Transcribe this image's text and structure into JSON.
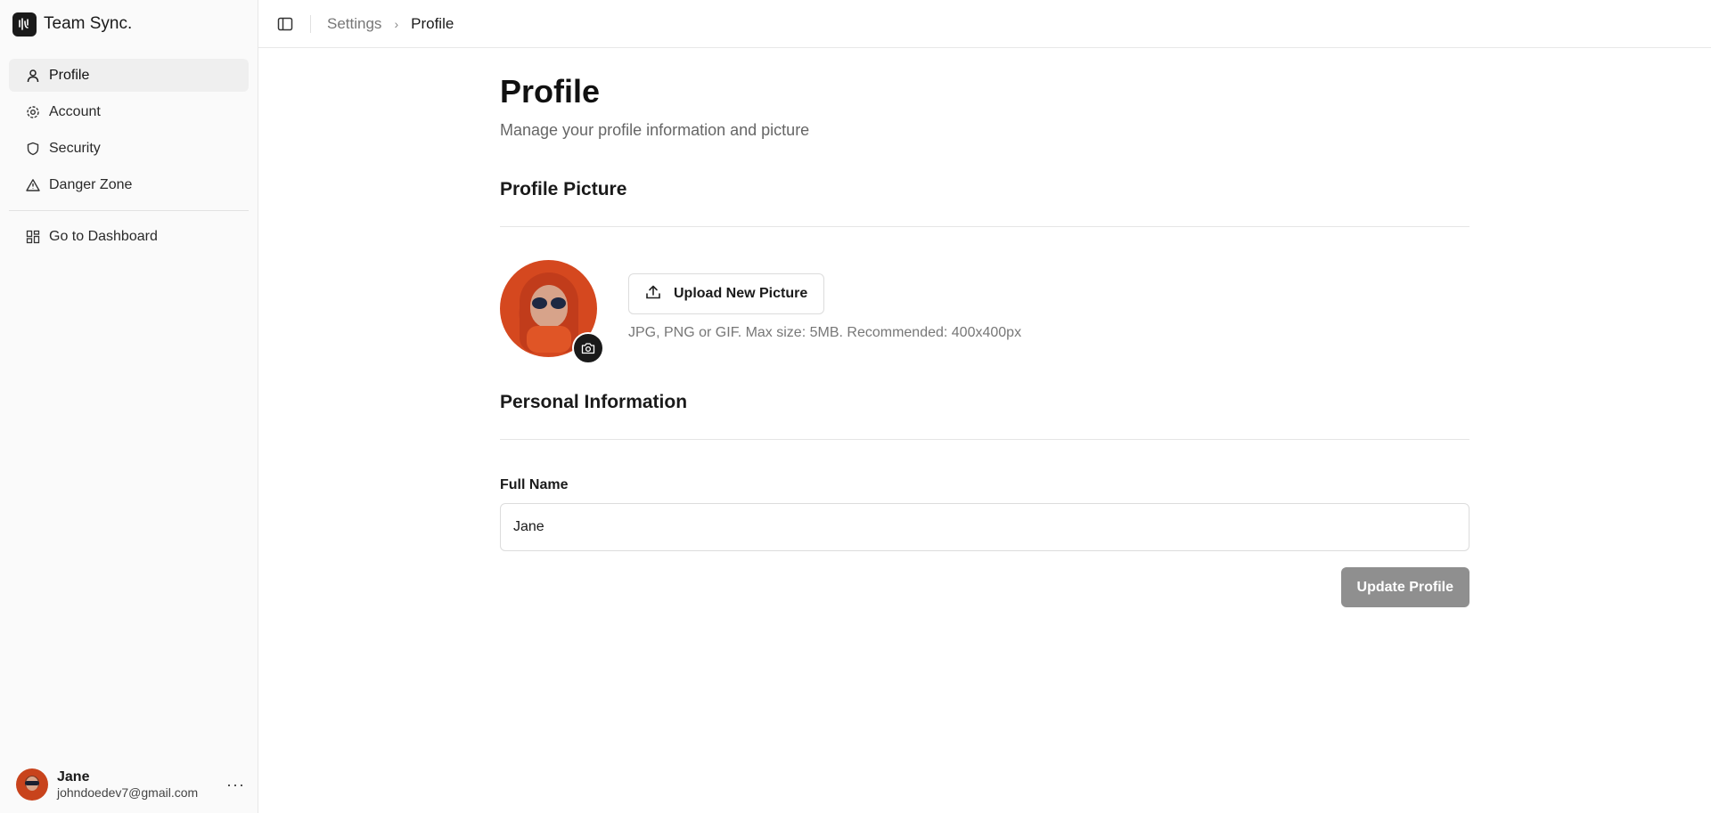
{
  "app": {
    "name": "Team Sync."
  },
  "sidebar": {
    "items": [
      {
        "label": "Profile",
        "icon": "user-icon",
        "active": true
      },
      {
        "label": "Account",
        "icon": "gear-icon"
      },
      {
        "label": "Security",
        "icon": "shield-icon"
      },
      {
        "label": "Danger Zone",
        "icon": "warning-triangle-icon"
      }
    ],
    "dashboard_link": {
      "label": "Go to Dashboard",
      "icon": "dashboard-grid-icon"
    },
    "user": {
      "name": "Jane",
      "email": "johndoedev7@gmail.com",
      "more": "···"
    }
  },
  "breadcrumb": {
    "items": [
      "Settings",
      "Profile"
    ],
    "separator": "›"
  },
  "page": {
    "title": "Profile",
    "subtitle": "Manage your profile information and picture"
  },
  "profile_picture": {
    "section_title": "Profile Picture",
    "upload_label": "Upload New Picture",
    "hint": "JPG, PNG or GIF. Max size: 5MB. Recommended: 400x400px"
  },
  "personal_info": {
    "section_title": "Personal Information",
    "full_name_label": "Full Name",
    "full_name_value": "Jane"
  },
  "actions": {
    "update_label": "Update Profile"
  },
  "colors": {
    "sidebar_bg": "#fafafa",
    "active_item_bg": "#efefef",
    "update_button_bg": "#8f8f8f",
    "avatar_accent": "#d5481f"
  }
}
